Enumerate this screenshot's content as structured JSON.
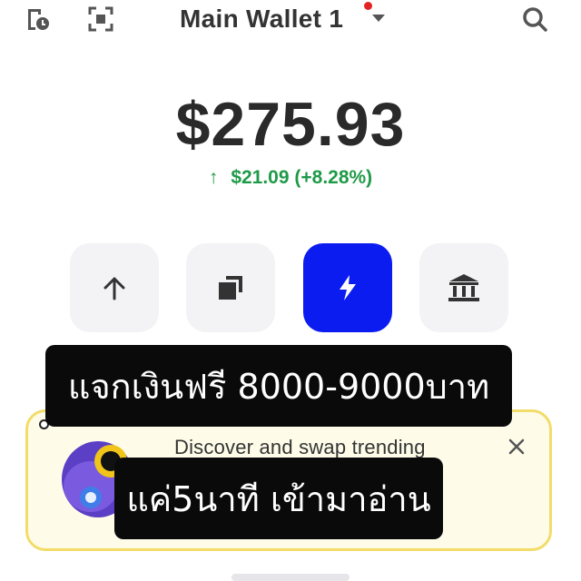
{
  "header": {
    "title": "Main Wallet 1",
    "has_notification": true,
    "icons": [
      "history-icon",
      "scan-icon",
      "chevron-down-icon",
      "search-icon"
    ]
  },
  "balance": {
    "amount": "$275.93",
    "change": "$21.09 (+8.28%)",
    "change_color": "#1f9a48"
  },
  "actions": [
    {
      "icon": "send-arrow-up-icon"
    },
    {
      "icon": "copy-receive-icon"
    },
    {
      "icon": "lightning-icon",
      "primary": true,
      "color": "#0a1cf0"
    },
    {
      "icon": "bank-icon"
    }
  ],
  "banner": {
    "text": "Discover and swap trending"
  },
  "overlays": {
    "line1": "แจกเงินฟรี 8000-9000บาท",
    "line2": "แค่5นาที เข้ามาอ่าน"
  }
}
